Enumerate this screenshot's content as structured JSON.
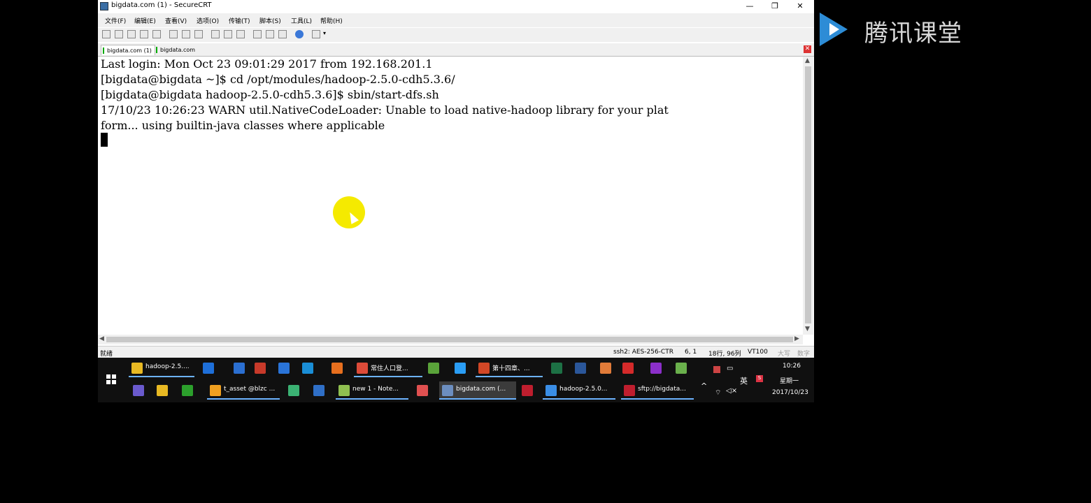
{
  "window": {
    "title": "bigdata.com (1) - SecureCRT",
    "minimize": "—",
    "maximize": "❐",
    "close": "✕"
  },
  "menu": [
    "文件(F)",
    "编辑(E)",
    "查看(V)",
    "选项(O)",
    "传输(T)",
    "脚本(S)",
    "工具(L)",
    "帮助(H)"
  ],
  "toolbar_icons": [
    "connect-icon",
    "quick-connect-icon",
    "connect-tab-icon",
    "reconnect-icon",
    "disconnect-icon",
    "copy-icon",
    "paste-icon",
    "find-icon",
    "print-icon",
    "print-setup-icon",
    "print-screen-icon",
    "session-options-icon",
    "global-options-icon",
    "keymap-icon",
    "help-icon",
    "sftp-icon",
    "toolbar-menu-icon"
  ],
  "tabs": [
    {
      "label": "bigdata.com (1)",
      "active": true
    },
    {
      "label": "bigdata.com",
      "active": false
    }
  ],
  "terminal": {
    "lines": [
      "Last login: Mon Oct 23 09:01:29 2017 from 192.168.201.1",
      "[bigdata@bigdata ~]$ cd /opt/modules/hadoop-2.5.0-cdh5.3.6/",
      "[bigdata@bigdata hadoop-2.5.0-cdh5.3.6]$ sbin/start-dfs.sh",
      "17/10/23 10:26:23 WARN util.NativeCodeLoader: Unable to load native-hadoop library for your plat",
      "form... using builtin-java classes where applicable"
    ]
  },
  "status": {
    "ready": "就绪",
    "cipher": "ssh2: AES-256-CTR",
    "cursor_pos": "6,  1",
    "size": "18行, 96列",
    "term_type": "VT100",
    "caps": "大写",
    "num": "数字"
  },
  "taskbar": {
    "row1": [
      {
        "label": "hadoop-2.5....",
        "color": "#e8b923",
        "open": true
      },
      {
        "label": "",
        "color": "#1e6fd9"
      },
      {
        "label": "",
        "color": "#2b6fd1"
      },
      {
        "label": "",
        "color": "#c83a2a"
      },
      {
        "label": "",
        "color": "#2a74d8"
      },
      {
        "label": "",
        "color": "#1a8ed6"
      },
      {
        "label": "",
        "color": "#e76f1e"
      },
      {
        "label": "常住人口登...",
        "color": "#dd4b39",
        "open": true
      },
      {
        "label": "",
        "color": "#5aa33a"
      },
      {
        "label": "",
        "color": "#2a9df4"
      },
      {
        "label": "第十四章、...",
        "color": "#d24726",
        "open": true
      },
      {
        "label": "",
        "color": "#1d7145"
      },
      {
        "label": "",
        "color": "#2b579a"
      },
      {
        "label": "",
        "color": "#e07b39"
      },
      {
        "label": "",
        "color": "#d42a2a"
      },
      {
        "label": "",
        "color": "#8b2fc9"
      },
      {
        "label": "",
        "color": "#6ab04c"
      }
    ],
    "row2": [
      {
        "label": "",
        "color": "#6a5acd"
      },
      {
        "label": "",
        "color": "#e8b923"
      },
      {
        "label": "",
        "color": "#2ca02c"
      },
      {
        "label": "t_asset @blzc ...",
        "color": "#f0a020",
        "open": true
      },
      {
        "label": "",
        "color": "#3bb273"
      },
      {
        "label": "",
        "color": "#2f6fc7"
      },
      {
        "label": "new  1 - Note...",
        "color": "#90c050",
        "open": true
      },
      {
        "label": "",
        "color": "#e05050"
      },
      {
        "label": "bigdata.com (...",
        "color": "#6c8ebf",
        "open": true,
        "selected": true
      },
      {
        "label": "",
        "color": "#bf1e2e"
      },
      {
        "label": "hadoop-2.5.0...",
        "color": "#3a8ee6",
        "open": true
      },
      {
        "label": "sftp://bigdata...",
        "color": "#bf1e2e",
        "open": true
      }
    ],
    "ime": "英",
    "time": "10:26",
    "weekday": "星期一",
    "date": "2017/10/23"
  },
  "branding": {
    "text": "腾讯课堂",
    "logo_color": "#2d8cd6"
  }
}
